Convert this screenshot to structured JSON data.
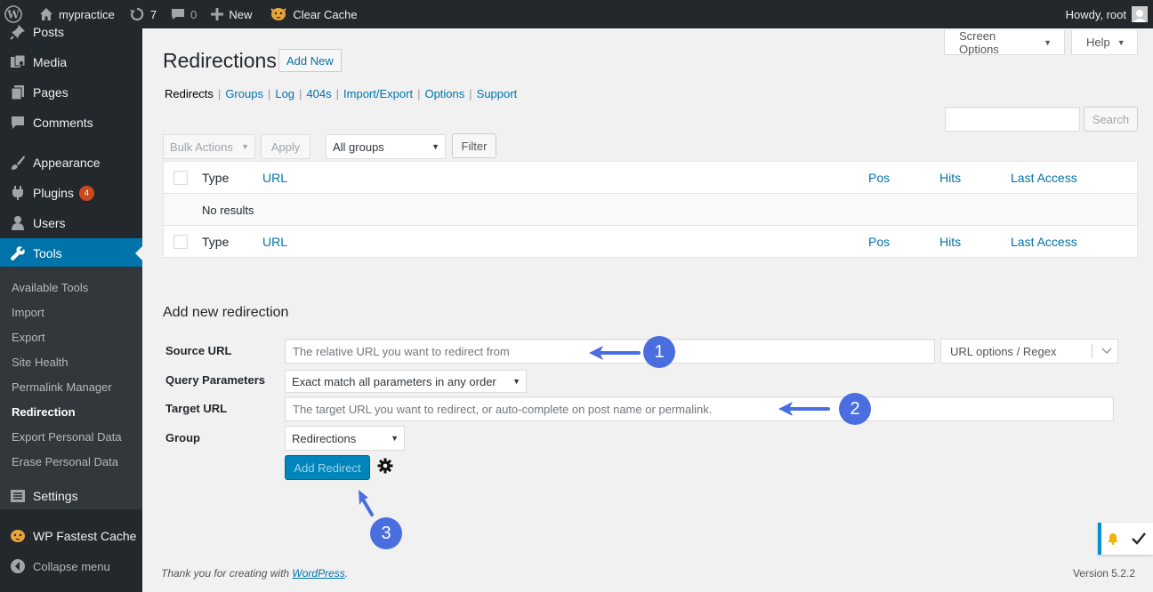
{
  "adminbar": {
    "site_name": "mypractice",
    "updates_count": "7",
    "comments_count": "0",
    "new_label": "New",
    "clear_cache_label": "Clear Cache",
    "howdy": "Howdy, root"
  },
  "sidebar": {
    "items": [
      {
        "label": "Posts",
        "icon": "pushpin-icon"
      },
      {
        "label": "Media",
        "icon": "media-icon"
      },
      {
        "label": "Pages",
        "icon": "pages-icon"
      },
      {
        "label": "Comments",
        "icon": "comment-icon"
      },
      {
        "label": "Appearance",
        "icon": "paintbrush-icon"
      },
      {
        "label": "Plugins",
        "icon": "plugin-icon",
        "badge": "4"
      },
      {
        "label": "Users",
        "icon": "user-icon"
      },
      {
        "label": "Tools",
        "icon": "wrench-icon"
      },
      {
        "label": "Settings",
        "icon": "settings-icon"
      },
      {
        "label": "WP Fastest Cache",
        "icon": "cheetah-icon"
      },
      {
        "label": "Collapse menu",
        "icon": "collapse-icon"
      }
    ],
    "submenu": [
      "Available Tools",
      "Import",
      "Export",
      "Site Health",
      "Permalink Manager",
      "Redirection",
      "Export Personal Data",
      "Erase Personal Data"
    ]
  },
  "header": {
    "screen_options": "Screen Options",
    "help": "Help",
    "title": "Redirections",
    "add_new": "Add New"
  },
  "subnav": [
    "Redirects",
    "Groups",
    "Log",
    "404s",
    "Import/Export",
    "Options",
    "Support"
  ],
  "search": {
    "button": "Search",
    "value": ""
  },
  "filters": {
    "bulk_actions": "Bulk Actions",
    "apply": "Apply",
    "group_select": "All groups",
    "filter": "Filter"
  },
  "table": {
    "columns": [
      "Type",
      "URL",
      "Pos",
      "Hits",
      "Last Access"
    ],
    "empty_message": "No results"
  },
  "form": {
    "heading": "Add new redirection",
    "source_label": "Source URL",
    "source_placeholder": "The relative URL you want to redirect from",
    "url_options": "URL options / Regex",
    "query_label": "Query Parameters",
    "query_value": "Exact match all parameters in any order",
    "target_label": "Target URL",
    "target_placeholder": "The target URL you want to redirect, or auto-complete on post name or permalink.",
    "group_label": "Group",
    "group_value": "Redirections",
    "submit": "Add Redirect"
  },
  "annotations": [
    "1",
    "2",
    "3"
  ],
  "annotation_color": "#4a6ee0",
  "footer": {
    "thanks_prefix": "Thank you for creating with ",
    "thanks_link": "WordPress",
    "thanks_suffix": ".",
    "version": "Version 5.2.2"
  },
  "colors": {
    "admin_dark": "#23282d",
    "accent_blue": "#0073aa",
    "primary_button": "#0085ba",
    "badge": "#ca4a1f"
  }
}
